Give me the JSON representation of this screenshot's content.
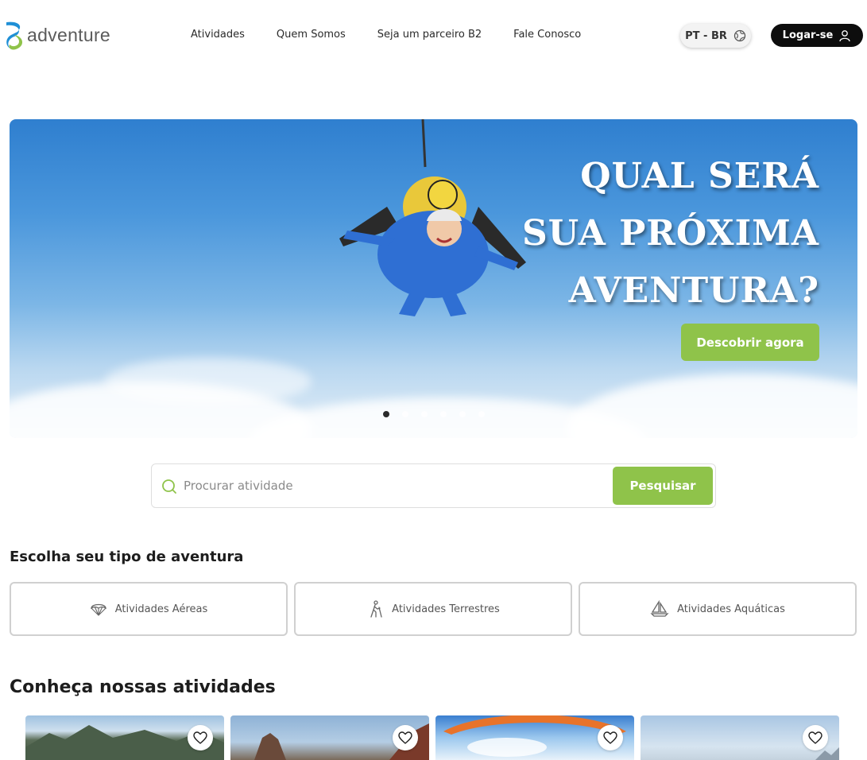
{
  "brand": {
    "name": "adventure",
    "accent": "#8fc34a",
    "logo_blue": "#1f8fd6"
  },
  "nav": {
    "items": [
      "Atividades",
      "Quem Somos",
      "Seja um parceiro B2",
      "Fale Conosco"
    ]
  },
  "lang": {
    "label": "PT - BR",
    "icon": "globe-icon"
  },
  "login": {
    "label": "Logar-se",
    "icon": "user-icon"
  },
  "hero": {
    "title_lines": [
      "QUAL SERÁ",
      "SUA PRÓXIMA",
      "AVENTURA?"
    ],
    "cta_label": "Descobrir agora",
    "slides_count": 6,
    "active_slide": 1
  },
  "search": {
    "placeholder": "Procurar atividade",
    "value": "",
    "button_label": "Pesquisar"
  },
  "categories_section": {
    "title": "Escolha seu tipo de aventura",
    "items": [
      {
        "label": "Atividades Aéreas",
        "icon": "parachute-icon"
      },
      {
        "label": "Atividades Terrestres",
        "icon": "hiking-icon"
      },
      {
        "label": "Atividades Aquáticas",
        "icon": "sailboat-icon"
      }
    ]
  },
  "activities_section": {
    "title": "Conheça nossas atividades",
    "cards": [
      {
        "image": "mountain-landscape",
        "fav_icon": "heart-icon"
      },
      {
        "image": "rock-peak",
        "fav_icon": "heart-icon"
      },
      {
        "image": "paraglider-sky",
        "fav_icon": "heart-icon"
      },
      {
        "image": "misty-sky",
        "fav_icon": "heart-icon"
      }
    ]
  }
}
